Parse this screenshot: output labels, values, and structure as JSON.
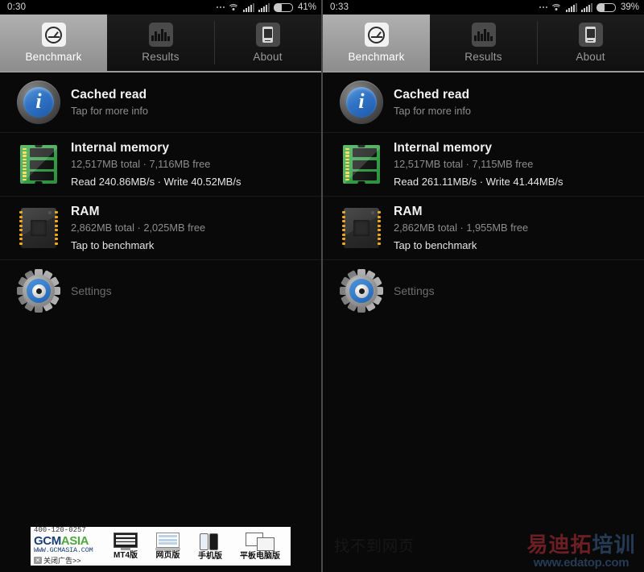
{
  "app": {
    "tabs": [
      {
        "label": "Benchmark",
        "icon": "gauge-icon",
        "active": true
      },
      {
        "label": "Results",
        "icon": "bar-chart-icon",
        "active": false
      },
      {
        "label": "About",
        "icon": "phone-icon",
        "active": false
      }
    ]
  },
  "left": {
    "status": {
      "clock": "0:30",
      "battery_percent": "41%",
      "battery_level": 41,
      "icons": [
        "more-dots-icon",
        "wifi-icon",
        "signal-icon",
        "signal-icon",
        "battery-icon"
      ]
    },
    "rows": {
      "cached_read": {
        "title": "Cached read",
        "subtitle": "Tap for more info",
        "icon": "info-icon"
      },
      "internal_memory": {
        "title": "Internal memory",
        "subtitle": "12,517MB total · 7,116MB free",
        "detail": "Read 240.86MB/s · Write 40.52MB/s",
        "icon": "memory-module-icon"
      },
      "ram": {
        "title": "RAM",
        "subtitle": "2,862MB total · 2,025MB free",
        "detail": "Tap to benchmark",
        "icon": "ram-chip-icon"
      },
      "settings": {
        "title": "Settings",
        "icon": "gear-icon"
      }
    },
    "ad": {
      "phone": "400-120-0257",
      "logo_primary": "GCM",
      "logo_secondary": "ASIA",
      "url": "WWW.GCMASIA.COM",
      "close_glyph": "✕",
      "close_text": "关闭广告>>",
      "items": [
        {
          "label": "MT4版",
          "thumb": "monitor-thumb"
        },
        {
          "label": "网页版",
          "thumb": "laptop-thumb"
        },
        {
          "label": "手机版",
          "thumb": "phones-thumb"
        },
        {
          "label": "平板电脑版",
          "thumb": "tablets-thumb"
        }
      ]
    }
  },
  "right": {
    "status": {
      "clock": "0:33",
      "battery_percent": "39%",
      "battery_level": 39,
      "icons": [
        "more-dots-icon",
        "wifi-icon",
        "signal-icon",
        "signal-icon",
        "battery-icon"
      ]
    },
    "rows": {
      "cached_read": {
        "title": "Cached read",
        "subtitle": "Tap for more info",
        "icon": "info-icon"
      },
      "internal_memory": {
        "title": "Internal memory",
        "subtitle": "12,517MB total · 7,115MB free",
        "detail": "Read 261.11MB/s · Write 41.44MB/s",
        "icon": "memory-module-icon"
      },
      "ram": {
        "title": "RAM",
        "subtitle": "2,862MB total · 1,955MB free",
        "detail": "Tap to benchmark",
        "icon": "ram-chip-icon"
      },
      "settings": {
        "title": "Settings",
        "icon": "gear-icon"
      }
    },
    "not_found_text": "找不到网页",
    "watermark": {
      "cn_red": "易迪拓",
      "cn_blue": "培训",
      "url": "www.edatop.com"
    }
  },
  "colors": {
    "background": "#090909",
    "tab_active": "#b0b0b0",
    "accent_blue": "#2f72c4",
    "memory_green": "#3fae52",
    "pin_yellow": "#f0a81e",
    "title_text": "#f2f2f2",
    "sub_text": "#8d8d8d"
  }
}
